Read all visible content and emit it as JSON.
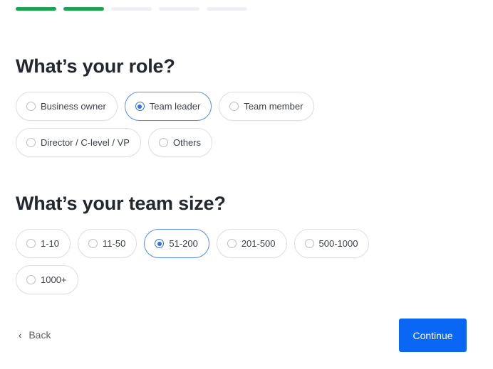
{
  "progress": {
    "total_steps": 5,
    "completed_steps": 2,
    "active_color": "#1ca352",
    "inactive_color": "#eef0f3"
  },
  "role": {
    "title": "What’s your role?",
    "options": [
      {
        "label": "Business owner",
        "selected": false
      },
      {
        "label": "Team leader",
        "selected": true
      },
      {
        "label": "Team member",
        "selected": false
      },
      {
        "label": "Director / C-level / VP",
        "selected": false
      },
      {
        "label": "Others",
        "selected": false
      }
    ]
  },
  "team_size": {
    "title": "What’s your team size?",
    "options": [
      {
        "label": "1-10",
        "selected": false
      },
      {
        "label": "11-50",
        "selected": false
      },
      {
        "label": "51-200",
        "selected": true
      },
      {
        "label": "201-500",
        "selected": false
      },
      {
        "label": "500-1000",
        "selected": false
      },
      {
        "label": "1000+",
        "selected": false
      }
    ]
  },
  "nav": {
    "back_label": "Back",
    "back_icon": "chevron-left-icon",
    "continue_label": "Continue",
    "accent_color": "#0a66f5"
  }
}
